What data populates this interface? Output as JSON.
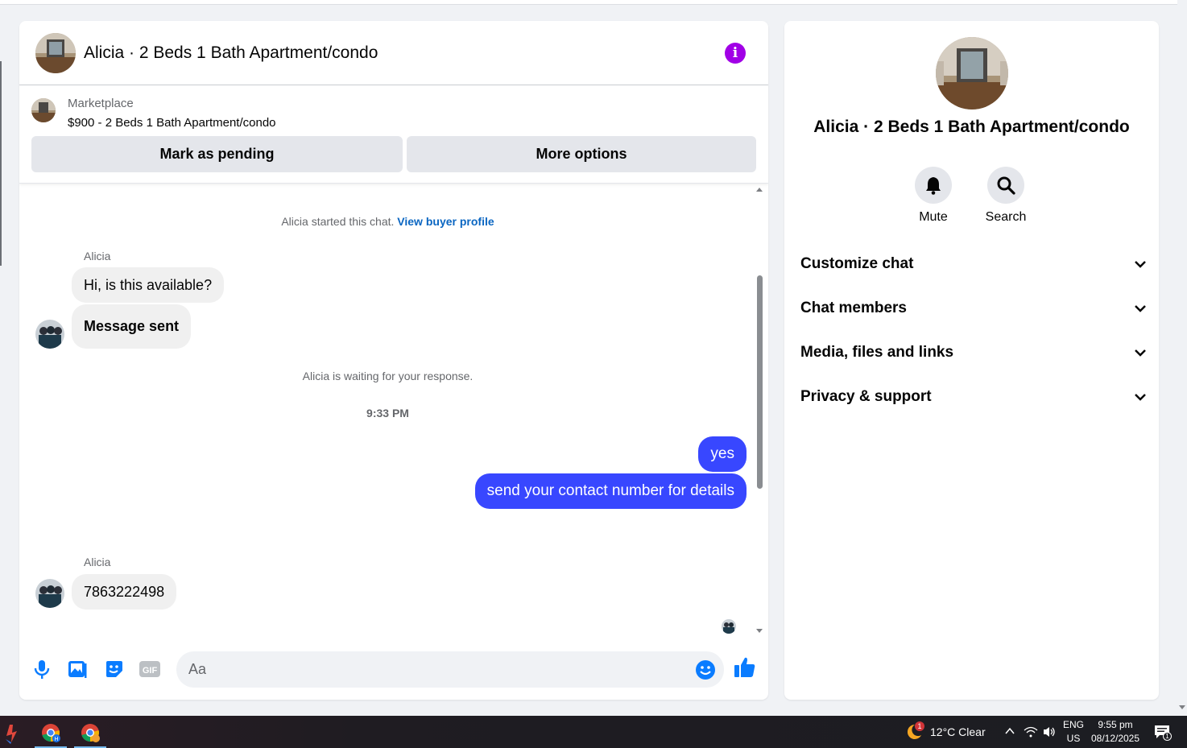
{
  "chat": {
    "title": "Alicia · 2 Beds 1 Bath Apartment/condo",
    "listing": {
      "source": "Marketplace",
      "price_title": "$900 - 2 Beds 1 Bath Apartment/condo",
      "mark_pending_label": "Mark as pending",
      "more_options_label": "More options"
    },
    "messages": {
      "started_text": "Alicia started this chat.",
      "buyer_profile_link": "View buyer profile",
      "sender_name_1": "Alicia",
      "msg_1": "Hi, is this available?",
      "msg_2": "Message sent",
      "waiting_text": "Alicia is waiting for your response.",
      "timestamp": "9:33 PM",
      "out_1": "yes",
      "out_2": "send your contact number for details",
      "sender_name_2": "Alicia",
      "msg_3": "7863222498"
    },
    "composer": {
      "placeholder": "Aa",
      "gif_label": "GIF"
    }
  },
  "side": {
    "title": "Alicia · 2 Beds 1 Bath Apartment/condo",
    "actions": [
      {
        "label": "Mute",
        "icon": "bell-icon"
      },
      {
        "label": "Search",
        "icon": "search-icon"
      }
    ],
    "sections": [
      {
        "label": "Customize chat"
      },
      {
        "label": "Chat members"
      },
      {
        "label": "Media, files and links"
      },
      {
        "label": "Privacy & support"
      }
    ]
  },
  "taskbar": {
    "weather": "12°C  Clear",
    "weather_badge": "1",
    "lang_1": "ENG",
    "lang_2": "US",
    "time": "9:55 pm",
    "date": "08/12/2025",
    "notification_count": "1"
  },
  "colors": {
    "outgoing_bubble": "#3847ff",
    "incoming_bubble": "#f0f0f0",
    "accent_icon": "#0a7cff",
    "info_button": "#a100e6",
    "link": "#0a66c2"
  }
}
